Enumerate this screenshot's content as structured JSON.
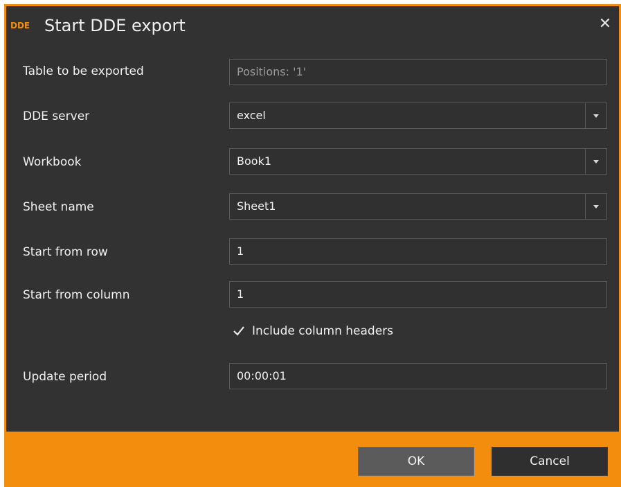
{
  "dialog": {
    "icon_text": "DDE",
    "title": "Start DDE export",
    "close_symbol": "✕"
  },
  "form": {
    "table": {
      "label": "Table to be exported",
      "value": "Positions: '1'"
    },
    "dde_server": {
      "label": "DDE server",
      "value": "excel"
    },
    "workbook": {
      "label": "Workbook",
      "value": "Book1"
    },
    "sheet": {
      "label": "Sheet name",
      "value": "Sheet1"
    },
    "start_row": {
      "label": "Start from row",
      "value": "1"
    },
    "start_col": {
      "label": "Start from column",
      "value": "1"
    },
    "include_headers": {
      "label": "Include column headers",
      "checked": true
    },
    "update_period": {
      "label": "Update period",
      "value": "00:00:01"
    }
  },
  "buttons": {
    "ok": "OK",
    "cancel": "Cancel"
  },
  "colors": {
    "accent": "#f28d0d",
    "background": "#323232"
  },
  "icons": {
    "close": "close-icon",
    "dropdown": "chevron-down-icon",
    "check": "check-icon"
  }
}
